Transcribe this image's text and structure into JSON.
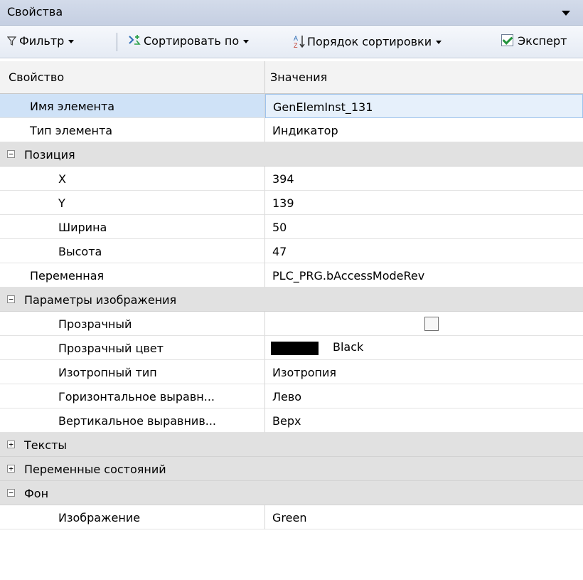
{
  "window": {
    "title": "Свойства"
  },
  "toolbar": {
    "filter": "Фильтр",
    "sort_by": "Сортировать по",
    "sort_order": "Порядок сортировки",
    "expert": "Эксперт",
    "expert_checked": true
  },
  "header": {
    "property": "Свойство",
    "values": "Значения"
  },
  "rows": {
    "name": {
      "label": "Имя элемента",
      "value": "GenElemInst_131"
    },
    "type": {
      "label": "Тип элемента",
      "value": "Индикатор"
    },
    "position": {
      "label": "Позиция",
      "expanded": true
    },
    "x": {
      "label": "X",
      "value": "394"
    },
    "y": {
      "label": "Y",
      "value": "139"
    },
    "width": {
      "label": "Ширина",
      "value": "50"
    },
    "height": {
      "label": "Высота",
      "value": "47"
    },
    "variable": {
      "label": "Переменная",
      "value": "PLC_PRG.bAccessModeRev"
    },
    "image_params": {
      "label": "Параметры изображения",
      "expanded": true
    },
    "transparent": {
      "label": "Прозрачный",
      "checked": false
    },
    "transparent_color": {
      "label": "Прозрачный цвет",
      "value": "Black",
      "swatch": "#000000"
    },
    "isotropic": {
      "label": "Изотропный тип",
      "value": "Изотропия"
    },
    "h_align": {
      "label": "Горизонтальное выравн...",
      "value": "Лево"
    },
    "v_align": {
      "label": "Вертикальное выравнив...",
      "value": "Верх"
    },
    "texts": {
      "label": "Тексты",
      "expanded": false
    },
    "state_vars": {
      "label": "Переменные состояний",
      "expanded": false
    },
    "background": {
      "label": "Фон",
      "expanded": true
    },
    "image": {
      "label": "Изображение",
      "value": "Green"
    }
  },
  "glyphs": {
    "plus": "+",
    "minus": "−"
  },
  "colors": {
    "selection": "#cfe2f7",
    "category": "#e1e1e1",
    "titlebar": "#c5cfe2"
  }
}
